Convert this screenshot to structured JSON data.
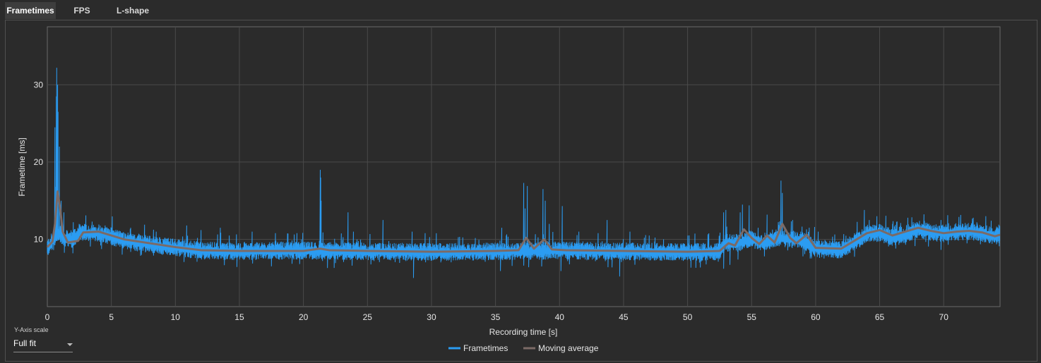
{
  "tabs": [
    {
      "label": "Frametimes",
      "active": true
    },
    {
      "label": "FPS",
      "active": false
    },
    {
      "label": "L-shape",
      "active": false
    }
  ],
  "y_axis_scale": {
    "label": "Y-Axis scale",
    "value": "Full fit"
  },
  "colors": {
    "frametimes": "#2b9cf2",
    "moving_average": "#7b6a66",
    "grid": "#4a4a4a",
    "plot_bg": "#2b2b2b"
  },
  "chart_data": {
    "type": "line",
    "xlabel": "Recording time [s]",
    "ylabel": "Frametime [ms]",
    "xlim": [
      0,
      74.4
    ],
    "ylim": [
      1.3,
      37.5
    ],
    "xticks": [
      0,
      5,
      10,
      15,
      20,
      25,
      30,
      35,
      40,
      45,
      50,
      55,
      60,
      65,
      70
    ],
    "yticks": [
      10,
      20,
      30
    ],
    "grid": true,
    "legend": {
      "position": "bottom-center",
      "entries": [
        "Frametimes",
        "Moving average"
      ]
    },
    "series": [
      {
        "name": "Frametimes",
        "color": "#2b9cf2",
        "baseline": [
          [
            0,
            8.8
          ],
          [
            0.5,
            10
          ],
          [
            0.9,
            11
          ],
          [
            1.3,
            10
          ],
          [
            2,
            10
          ],
          [
            2.5,
            10.8
          ],
          [
            4,
            10.8
          ],
          [
            6,
            9.8
          ],
          [
            8,
            9.3
          ],
          [
            10,
            8.9
          ],
          [
            12,
            8.5
          ],
          [
            15,
            8.4
          ],
          [
            20,
            8.5
          ],
          [
            25,
            8.4
          ],
          [
            30,
            8.3
          ],
          [
            35,
            8.4
          ],
          [
            40,
            8.5
          ],
          [
            45,
            8.4
          ],
          [
            50,
            8.3
          ],
          [
            52.5,
            8.4
          ],
          [
            53,
            9.5
          ],
          [
            54,
            9.5
          ],
          [
            55,
            10
          ],
          [
            56,
            9.5
          ],
          [
            57,
            10.2
          ],
          [
            58,
            10
          ],
          [
            59,
            9.8
          ],
          [
            60,
            8.8
          ],
          [
            62,
            8.6
          ],
          [
            63,
            9.6
          ],
          [
            64,
            10.6
          ],
          [
            65,
            10.8
          ],
          [
            66,
            10.2
          ],
          [
            67,
            10.6
          ],
          [
            68,
            11.3
          ],
          [
            69,
            10.9
          ],
          [
            70,
            10.7
          ],
          [
            71,
            10.9
          ],
          [
            72,
            11
          ],
          [
            73,
            10.8
          ],
          [
            74,
            10.3
          ],
          [
            74.4,
            10.6
          ]
        ],
        "spikes": [
          [
            0.6,
            24.5
          ],
          [
            0.65,
            16.8
          ],
          [
            0.7,
            28.5
          ],
          [
            0.75,
            32.2
          ],
          [
            0.8,
            30
          ],
          [
            0.85,
            26.5
          ],
          [
            0.95,
            22
          ],
          [
            1.1,
            15
          ],
          [
            1.3,
            13.5
          ],
          [
            2.5,
            12
          ],
          [
            3.5,
            12.3
          ],
          [
            4.5,
            11.8
          ],
          [
            6.5,
            11.5
          ],
          [
            8.5,
            11
          ],
          [
            10.9,
            11.8
          ],
          [
            12,
            11.2
          ],
          [
            13.5,
            11.5
          ],
          [
            16,
            11
          ],
          [
            17.8,
            10.8
          ],
          [
            19.5,
            10.8
          ],
          [
            21.3,
            19
          ],
          [
            21.35,
            18
          ],
          [
            21.4,
            15
          ],
          [
            23.5,
            13.5
          ],
          [
            23.9,
            11
          ],
          [
            26.2,
            12.5
          ],
          [
            28.5,
            11
          ],
          [
            29.5,
            10.8
          ],
          [
            35.5,
            11.5
          ],
          [
            37.2,
            17.3
          ],
          [
            37.3,
            14
          ],
          [
            37.5,
            16.9
          ],
          [
            38.7,
            16.5
          ],
          [
            38.9,
            15
          ],
          [
            39.2,
            12
          ],
          [
            40.2,
            14.3
          ],
          [
            41.5,
            11
          ],
          [
            43,
            10.8
          ],
          [
            43.7,
            12.5
          ],
          [
            45.5,
            11
          ],
          [
            47,
            10.5
          ],
          [
            50,
            10.5
          ],
          [
            52.8,
            13.5
          ],
          [
            53,
            13.8
          ],
          [
            54.1,
            13.5
          ],
          [
            54.3,
            14.5
          ],
          [
            54.8,
            14.4
          ],
          [
            55.5,
            11.5
          ],
          [
            56.2,
            13.2
          ],
          [
            57.3,
            17.6
          ],
          [
            57.4,
            16
          ],
          [
            58.2,
            12.5
          ],
          [
            59.3,
            11.3
          ],
          [
            60.2,
            11
          ],
          [
            61.5,
            10.5
          ],
          [
            63.8,
            13.8
          ],
          [
            64.2,
            12.5
          ],
          [
            64.8,
            13
          ],
          [
            66,
            12
          ],
          [
            67.2,
            12.8
          ],
          [
            68.5,
            12.4
          ],
          [
            69.8,
            12.5
          ],
          [
            71.2,
            12.9
          ],
          [
            72.3,
            12.8
          ],
          [
            73.3,
            13
          ],
          [
            74.3,
            11.9
          ]
        ],
        "dips": [
          [
            2,
            8.2
          ],
          [
            9,
            8
          ],
          [
            12,
            7.6
          ],
          [
            15,
            7.4
          ],
          [
            18,
            7.5
          ],
          [
            21.5,
            7.2
          ],
          [
            22.4,
            6.3
          ],
          [
            23.8,
            6.6
          ],
          [
            25.5,
            7.2
          ],
          [
            28.6,
            5
          ],
          [
            30,
            7.4
          ],
          [
            33,
            7.4
          ],
          [
            35.4,
            5.9
          ],
          [
            37.2,
            6.6
          ],
          [
            38.6,
            6.5
          ],
          [
            40.1,
            5.9
          ],
          [
            43.8,
            6.4
          ],
          [
            44.7,
            5.2
          ],
          [
            46,
            7.5
          ],
          [
            48,
            7.6
          ],
          [
            50,
            7.4
          ],
          [
            52.8,
            6.2
          ],
          [
            53.3,
            6.7
          ],
          [
            56,
            7.8
          ],
          [
            59,
            7.8
          ],
          [
            60.3,
            7.6
          ]
        ]
      },
      {
        "name": "Moving average",
        "color": "#7b6a66",
        "points": [
          [
            0,
            9
          ],
          [
            0.4,
            9.7
          ],
          [
            0.6,
            12
          ],
          [
            0.8,
            16.2
          ],
          [
            1,
            14
          ],
          [
            1.2,
            11
          ],
          [
            1.6,
            9.6
          ],
          [
            2.4,
            9.8
          ],
          [
            2.8,
            10.9
          ],
          [
            4,
            11
          ],
          [
            6,
            10
          ],
          [
            8,
            9.5
          ],
          [
            10,
            9
          ],
          [
            12,
            8.6
          ],
          [
            15,
            8.5
          ],
          [
            20,
            8.5
          ],
          [
            21.3,
            8.8
          ],
          [
            22,
            8.6
          ],
          [
            25,
            8.5
          ],
          [
            30,
            8.4
          ],
          [
            35,
            8.5
          ],
          [
            36.8,
            8.6
          ],
          [
            37.4,
            10.2
          ],
          [
            38,
            8.8
          ],
          [
            38.8,
            10
          ],
          [
            39.4,
            8.7
          ],
          [
            40.5,
            8.6
          ],
          [
            45,
            8.5
          ],
          [
            50,
            8.4
          ],
          [
            52.5,
            8.5
          ],
          [
            53.2,
            9.5
          ],
          [
            53.7,
            9.2
          ],
          [
            54.4,
            11.3
          ],
          [
            55,
            10.2
          ],
          [
            55.6,
            9.4
          ],
          [
            56.2,
            10.5
          ],
          [
            56.8,
            9.6
          ],
          [
            57.4,
            12
          ],
          [
            58,
            10.2
          ],
          [
            58.5,
            9.5
          ],
          [
            59.3,
            10.6
          ],
          [
            60,
            8.9
          ],
          [
            62,
            8.8
          ],
          [
            63,
            9.8
          ],
          [
            64,
            10.8
          ],
          [
            65,
            11.2
          ],
          [
            66,
            10.5
          ],
          [
            67,
            11
          ],
          [
            68,
            11.5
          ],
          [
            69,
            11.1
          ],
          [
            70,
            10.8
          ],
          [
            71,
            11
          ],
          [
            72,
            11.1
          ],
          [
            73,
            10.9
          ],
          [
            74,
            10.4
          ],
          [
            74.4,
            10.6
          ]
        ]
      }
    ]
  }
}
